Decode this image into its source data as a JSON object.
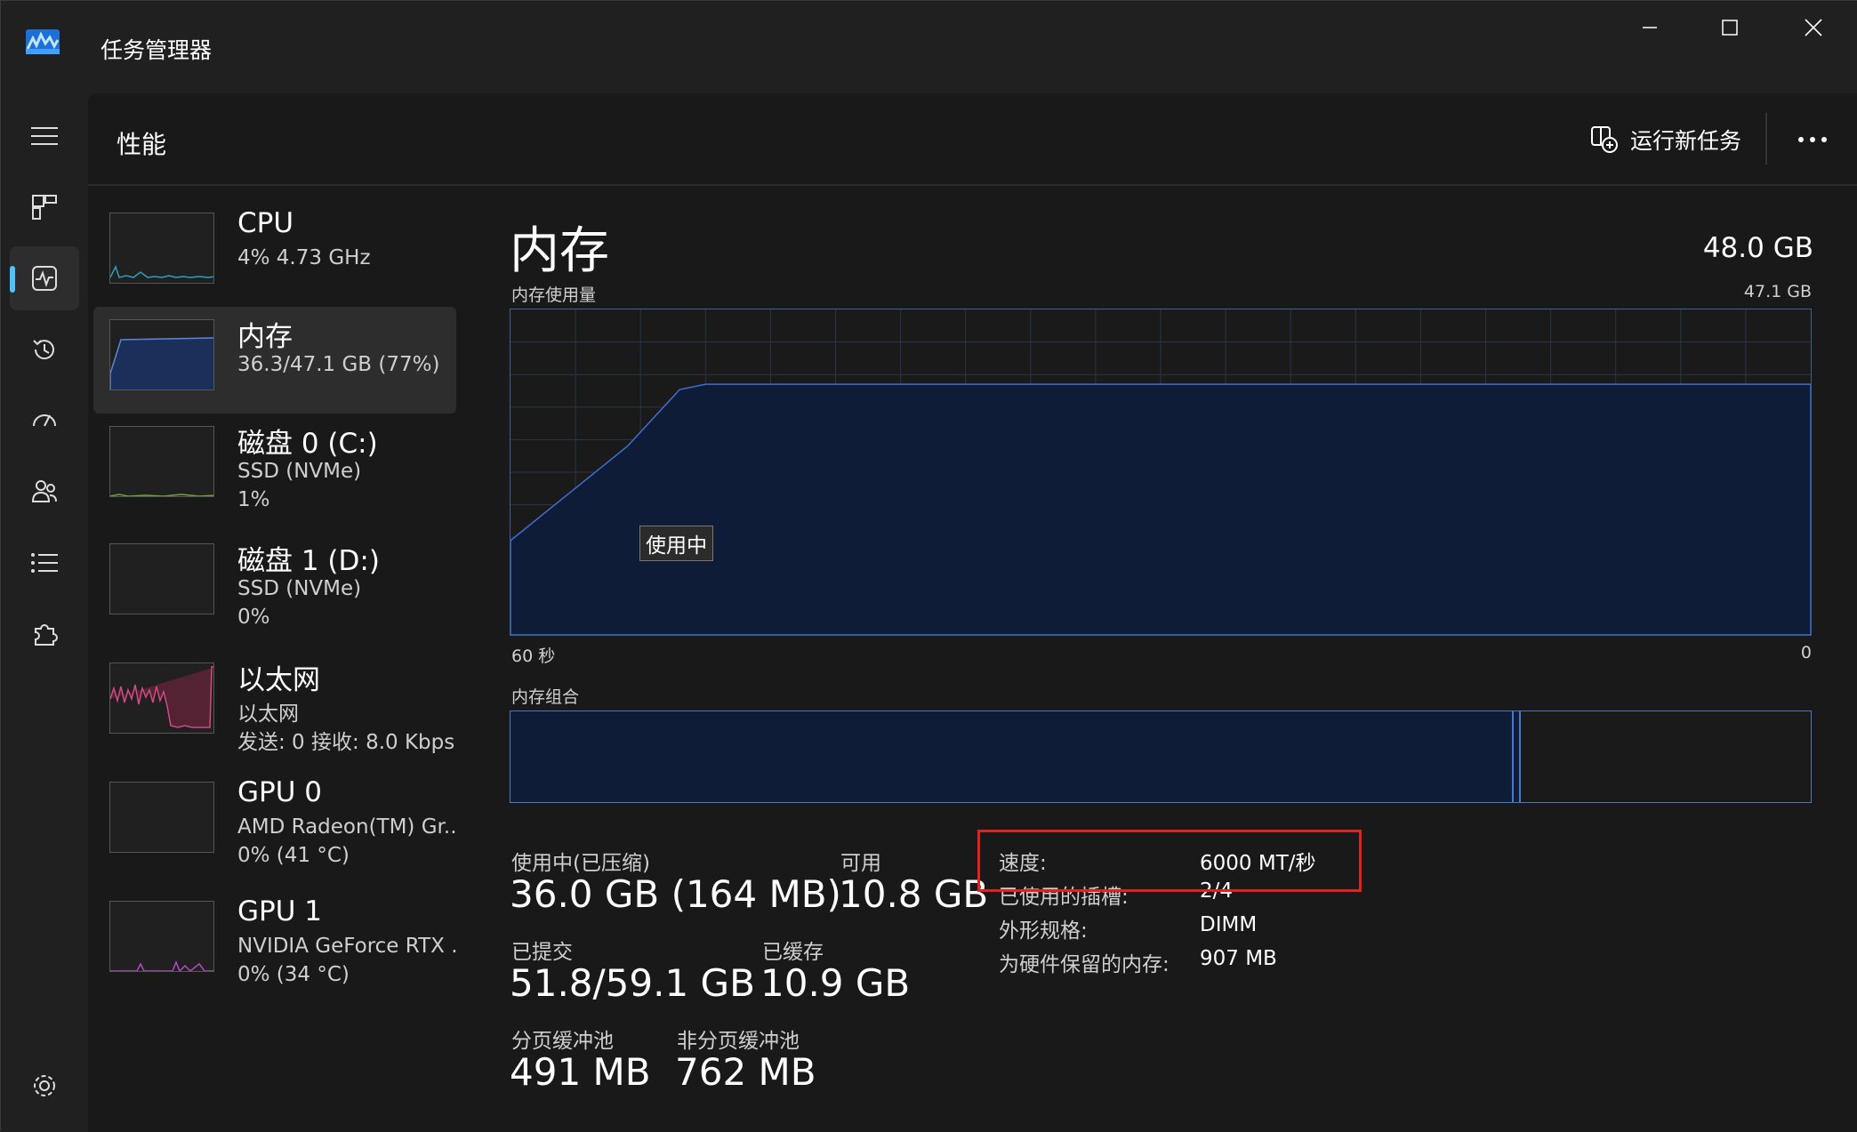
{
  "app": {
    "title": "任务管理器"
  },
  "page": {
    "title": "性能",
    "run_task_label": "运行新任务"
  },
  "nav": {
    "items": [
      {
        "name": "menu"
      },
      {
        "name": "processes"
      },
      {
        "name": "performance",
        "active": true
      },
      {
        "name": "app-history"
      },
      {
        "name": "startup"
      },
      {
        "name": "users"
      },
      {
        "name": "details"
      },
      {
        "name": "services"
      },
      {
        "name": "settings"
      }
    ]
  },
  "devices": [
    {
      "name": "CPU",
      "line1": "4% 4.73 GHz",
      "line2": ""
    },
    {
      "name": "内存",
      "line1": "36.3/47.1 GB (77%)",
      "line2": ""
    },
    {
      "name": "磁盘 0 (C:)",
      "line1": "SSD (NVMe)",
      "line2": "1%"
    },
    {
      "name": "磁盘 1 (D:)",
      "line1": "SSD (NVMe)",
      "line2": "0%"
    },
    {
      "name": "以太网",
      "line1": "以太网",
      "line2": "发送: 0 接收: 8.0 Kbps"
    },
    {
      "name": "GPU 0",
      "line1": "AMD Radeon(TM) Gr..",
      "line2": "0% (41 °C)"
    },
    {
      "name": "GPU 1",
      "line1": "NVIDIA GeForce RTX .",
      "line2": "0% (34 °C)"
    }
  ],
  "memory": {
    "title": "内存",
    "total": "48.0 GB",
    "usage_label": "内存使用量",
    "usage_max": "47.1 GB",
    "time_left": "60 秒",
    "time_right": "0",
    "tooltip": "使用中",
    "composition_label": "内存组合",
    "stats": {
      "in_use_label": "使用中(已压缩)",
      "in_use_value": "36.0 GB (164 MB)",
      "available_label": "可用",
      "available_value": "10.8 GB",
      "committed_label": "已提交",
      "committed_value": "51.8/59.1 GB",
      "cached_label": "已缓存",
      "cached_value": "10.9 GB",
      "paged_label": "分页缓冲池",
      "paged_value": "491 MB",
      "nonpaged_label": "非分页缓冲池",
      "nonpaged_value": "762 MB"
    },
    "details": {
      "speed_key": "速度:",
      "speed_val": "6000 MT/秒",
      "slots_key": "已使用的插槽:",
      "slots_val": "2/4",
      "form_key": "外形规格:",
      "form_val": "DIMM",
      "reserved_key": "为硬件保留的内存:",
      "reserved_val": "907 MB"
    },
    "usage_fraction": 0.77,
    "composition_in_use_fraction": 0.77
  },
  "colors": {
    "memory_fill": "#0f1c38",
    "memory_line": "#3f6fcf",
    "highlight": "#e0231e",
    "accent": "#4cc2ff"
  }
}
